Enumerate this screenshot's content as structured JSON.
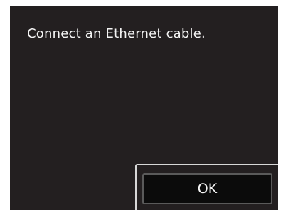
{
  "dialog": {
    "message": "Connect an Ethernet cable.",
    "ok_label": "OK"
  },
  "colors": {
    "screen_background": "#231f20",
    "text": "#f4f4f4",
    "button_background": "#0b0b0b",
    "selection_frame": "#d7d7d7"
  }
}
